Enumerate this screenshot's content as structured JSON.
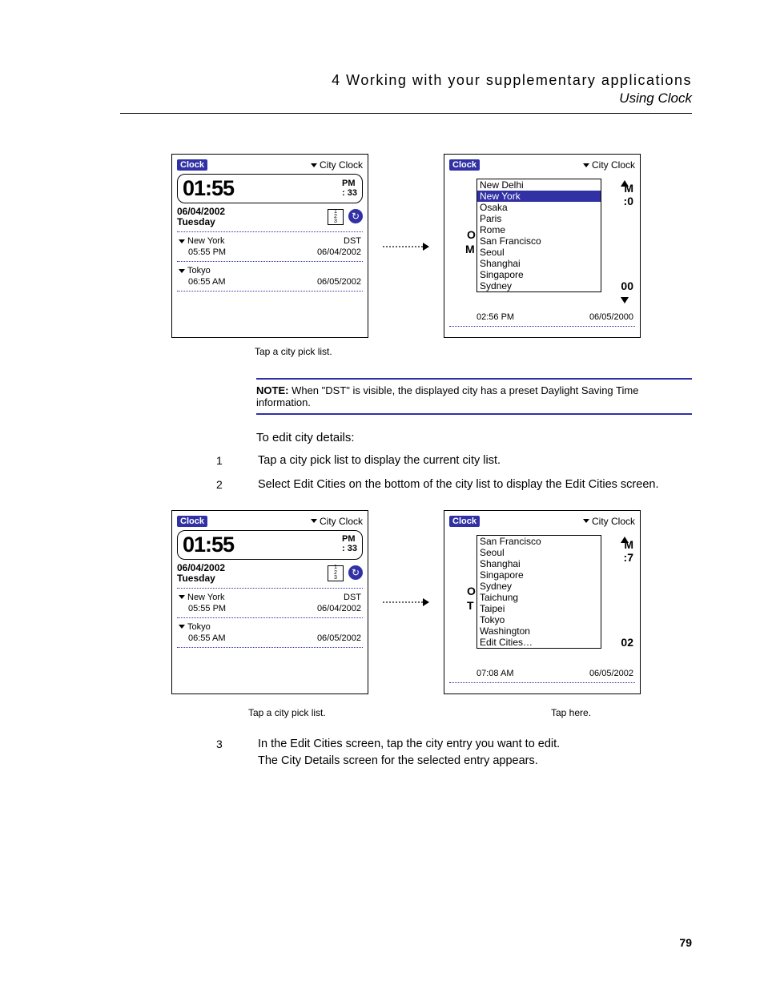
{
  "header": {
    "chapter": "4 Working with your supplementary applications",
    "section": "Using Clock"
  },
  "page_number": "79",
  "device_common": {
    "clock_label": "Clock",
    "city_clock_label": "City Clock",
    "big_time": "01:55",
    "pm": "PM",
    "seconds": ": 33",
    "date": "06/04/2002",
    "day": "Tuesday",
    "icon_cal_lines": [
      "1",
      "2",
      "3"
    ],
    "icon_globe": "↻",
    "city1_name": "New York",
    "city1_dst": "DST",
    "city1_time": "05:55 PM",
    "city1_date": "06/04/2002",
    "city2_name": "Tokyo",
    "city2_time": "06:55 AM",
    "city2_date": "06/05/2002"
  },
  "fig1": {
    "caption_left": "Tap a city pick list.",
    "list": [
      "New Delhi",
      "New York",
      "Osaka",
      "Paris",
      "Rome",
      "San Francisco",
      "Seoul",
      "Shanghai",
      "Singapore",
      "Sydney"
    ],
    "selected_index": 1,
    "bg_frags": {
      "top_right": "M",
      "mid_right": ":0",
      "mid_left": "O",
      "mid2_left": "M",
      "bot_right": "00"
    },
    "bottom_time": "02:56 PM",
    "bottom_date": "06/05/2000"
  },
  "note": {
    "label": "NOTE:",
    "text": "When \"DST\" is visible, the displayed city has a preset Daylight Saving Time information."
  },
  "edit_heading": "To edit city details:",
  "steps_a": [
    "Tap a city pick list to display the current city list.",
    "Select Edit Cities on the bottom of the city list to display the Edit Cities screen."
  ],
  "fig2": {
    "caption_left": "Tap a city pick list.",
    "caption_right": "Tap here.",
    "list": [
      "San Francisco",
      "Seoul",
      "Shanghai",
      "Singapore",
      "Sydney",
      "Taichung",
      "Taipei",
      "Tokyo",
      "Washington",
      "Edit Cities…"
    ],
    "bg_frags": {
      "top_right": "M",
      "mid_right": ":7",
      "mid_left": "O",
      "mid2_left": "T",
      "bot_right": "02"
    },
    "bottom_time": "07:08 AM",
    "bottom_date": "06/05/2002"
  },
  "steps_b": [
    "In the Edit Cities screen, tap the city entry you want to edit."
  ],
  "step3_followup": "The City Details screen for the selected entry appears."
}
